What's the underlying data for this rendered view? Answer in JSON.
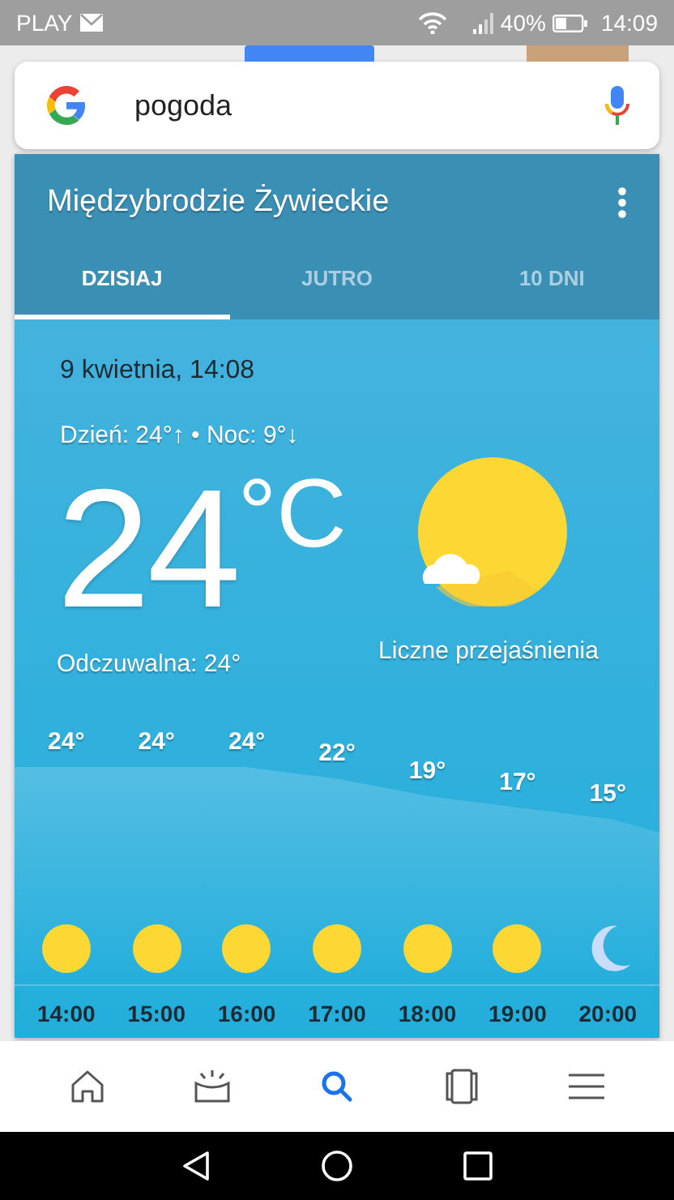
{
  "status_bar": {
    "carrier": "PLAY",
    "battery": "40%",
    "time": "14:09"
  },
  "search": {
    "value": "pogoda"
  },
  "weather_card": {
    "location": "Międzybrodzie Żywieckie",
    "tabs": [
      {
        "label": "DZISIAJ",
        "selected": true
      },
      {
        "label": "JUTRO",
        "selected": false
      },
      {
        "label": "10 DNI",
        "selected": false
      }
    ],
    "date": "9 kwietnia, 14:08",
    "day_night": "Dzień: 24°↑ • Noc: 9°↓",
    "temperature": "24",
    "unit": "°C",
    "condition_icon": {
      "kind": "sun-cloud"
    },
    "feels_like": "Odczuwalna: 24°",
    "condition": "Liczne przejaśnienia",
    "hourly": [
      {
        "temp": "24°",
        "kind": "sun",
        "time": "14:00"
      },
      {
        "temp": "24°",
        "kind": "sun",
        "time": "15:00"
      },
      {
        "temp": "24°",
        "kind": "sun",
        "time": "16:00"
      },
      {
        "temp": "22°",
        "kind": "sun",
        "time": "17:00"
      },
      {
        "temp": "19°",
        "kind": "sun",
        "time": "18:00"
      },
      {
        "temp": "17°",
        "kind": "sun",
        "time": "19:00"
      },
      {
        "temp": "15°",
        "kind": "moon",
        "time": "20:00"
      }
    ]
  },
  "bottom_nav": [
    {
      "kind": "home",
      "selected": false
    },
    {
      "kind": "updates",
      "selected": false
    },
    {
      "kind": "search",
      "selected": true
    },
    {
      "kind": "recents",
      "selected": false
    },
    {
      "kind": "menu",
      "selected": false
    }
  ]
}
